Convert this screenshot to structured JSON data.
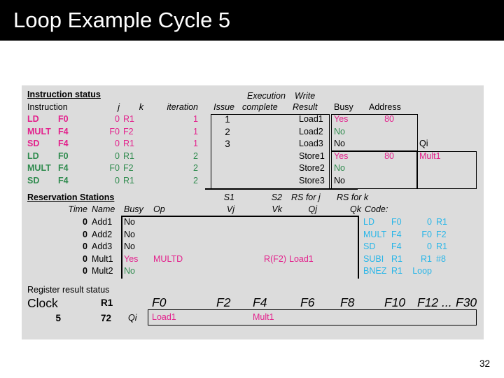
{
  "slide": {
    "title": "Loop Example Cycle 5",
    "page_number": "32"
  },
  "instruction_status": {
    "section_title": "Instruction status",
    "headers": {
      "instruction": "Instruction",
      "j": "j",
      "k": "k",
      "iteration": "iteration",
      "issue": "Issue",
      "execution": "Execution",
      "complete": "complete",
      "write": "Write",
      "result": "Result"
    },
    "rows": [
      {
        "op": "LD",
        "dest": "F0",
        "j": "0",
        "k": "R1",
        "iteration": "1",
        "issue": "1",
        "exec": "",
        "write": "",
        "color": "pink"
      },
      {
        "op": "MULT",
        "dest": "F4",
        "j": "F0",
        "k": "F2",
        "iteration": "1",
        "issue": "2",
        "exec": "",
        "write": "",
        "color": "pink"
      },
      {
        "op": "SD",
        "dest": "F4",
        "j": "0",
        "k": "R1",
        "iteration": "1",
        "issue": "3",
        "exec": "",
        "write": "",
        "color": "pink"
      },
      {
        "op": "LD",
        "dest": "F0",
        "j": "0",
        "k": "R1",
        "iteration": "2",
        "issue": "",
        "exec": "",
        "write": "",
        "color": "green"
      },
      {
        "op": "MULT",
        "dest": "F4",
        "j": "F0",
        "k": "F2",
        "iteration": "2",
        "issue": "",
        "exec": "",
        "write": "",
        "color": "green"
      },
      {
        "op": "SD",
        "dest": "F4",
        "j": "0",
        "k": "R1",
        "iteration": "2",
        "issue": "",
        "exec": "",
        "write": "",
        "color": "green"
      }
    ]
  },
  "load_store_units": {
    "headers": {
      "busy": "Busy",
      "address": "Address",
      "qi": "Qi"
    },
    "rows": [
      {
        "name": "Load1",
        "busy": "Yes",
        "busy_color": "pink",
        "address": "80",
        "qi": ""
      },
      {
        "name": "Load2",
        "busy": "No",
        "busy_color": "green",
        "address": "",
        "qi": ""
      },
      {
        "name": "Load3",
        "busy": "No",
        "busy_color": "black",
        "address": "",
        "qi": ""
      },
      {
        "name": "Store1",
        "busy": "Yes",
        "busy_color": "pink",
        "address": "80",
        "qi": "Mult1"
      },
      {
        "name": "Store2",
        "busy": "No",
        "busy_color": "green",
        "address": "",
        "qi": ""
      },
      {
        "name": "Store3",
        "busy": "No",
        "busy_color": "black",
        "address": "",
        "qi": ""
      }
    ]
  },
  "reservation_stations": {
    "section_title": "Reservation Stations",
    "headers": {
      "time": "Time",
      "name": "Name",
      "busy": "Busy",
      "op": "Op",
      "s1": "S1",
      "s2": "S2",
      "vj": "Vj",
      "vk": "Vk",
      "rs_for_j": "RS for j",
      "rs_for_k": "RS for k",
      "qj": "Qj",
      "qk": "Qk"
    },
    "rows": [
      {
        "time": "0",
        "name": "Add1",
        "busy": "No",
        "busy_color": "black",
        "op": "",
        "vj": "",
        "vk": "",
        "qj": "",
        "qk": ""
      },
      {
        "time": "0",
        "name": "Add2",
        "busy": "No",
        "busy_color": "black",
        "op": "",
        "vj": "",
        "vk": "",
        "qj": "",
        "qk": ""
      },
      {
        "time": "0",
        "name": "Add3",
        "busy": "No",
        "busy_color": "black",
        "op": "",
        "vj": "",
        "vk": "",
        "qj": "",
        "qk": ""
      },
      {
        "time": "0",
        "name": "Mult1",
        "busy": "Yes",
        "busy_color": "pink",
        "op": "MULTD",
        "vj": "",
        "vk": "R(F2)",
        "qj": "Load1",
        "qk": ""
      },
      {
        "time": "0",
        "name": "Mult2",
        "busy": "No",
        "busy_color": "green",
        "op": "",
        "vj": "",
        "vk": "",
        "qj": "",
        "qk": ""
      }
    ]
  },
  "code": {
    "label": "Code:",
    "lines": [
      {
        "op": "LD",
        "a": "F0",
        "b": "0",
        "c": "R1"
      },
      {
        "op": "MULT",
        "a": "F4",
        "b": "F0",
        "c": "F2"
      },
      {
        "op": "SD",
        "a": "F4",
        "b": "0",
        "c": "R1"
      },
      {
        "op": "SUBI",
        "a": "R1",
        "b": "R1",
        "c": "#8"
      },
      {
        "op": "BNEZ",
        "a": "R1",
        "b": "Loop",
        "c": ""
      }
    ]
  },
  "register_result_status": {
    "section_title": "Register result status",
    "clock_label": "Clock",
    "clock_value": "5",
    "r1_label": "R1",
    "r1_value": "72",
    "qi_label": "Qi",
    "registers": [
      "F0",
      "F2",
      "F4",
      "F6",
      "F8",
      "F10",
      "F12 ...",
      "F30"
    ],
    "values": [
      {
        "reg": "F0",
        "value": "Load1",
        "color": "pink"
      },
      {
        "reg": "F2",
        "value": "",
        "color": "pink"
      },
      {
        "reg": "F4",
        "value": "Mult1",
        "color": "pink"
      },
      {
        "reg": "F6",
        "value": "",
        "color": "pink"
      },
      {
        "reg": "F8",
        "value": "",
        "color": "pink"
      },
      {
        "reg": "F10",
        "value": "",
        "color": "pink"
      },
      {
        "reg": "F12 ...",
        "value": "",
        "color": "pink"
      },
      {
        "reg": "F30",
        "value": "",
        "color": "pink"
      }
    ]
  },
  "colors": {
    "pink": "#e3218c",
    "green": "#2f8b4e",
    "cyan": "#29b6e8",
    "black": "#000000",
    "panel_bg": "#dcdcdc",
    "title_bg": "#000000"
  }
}
